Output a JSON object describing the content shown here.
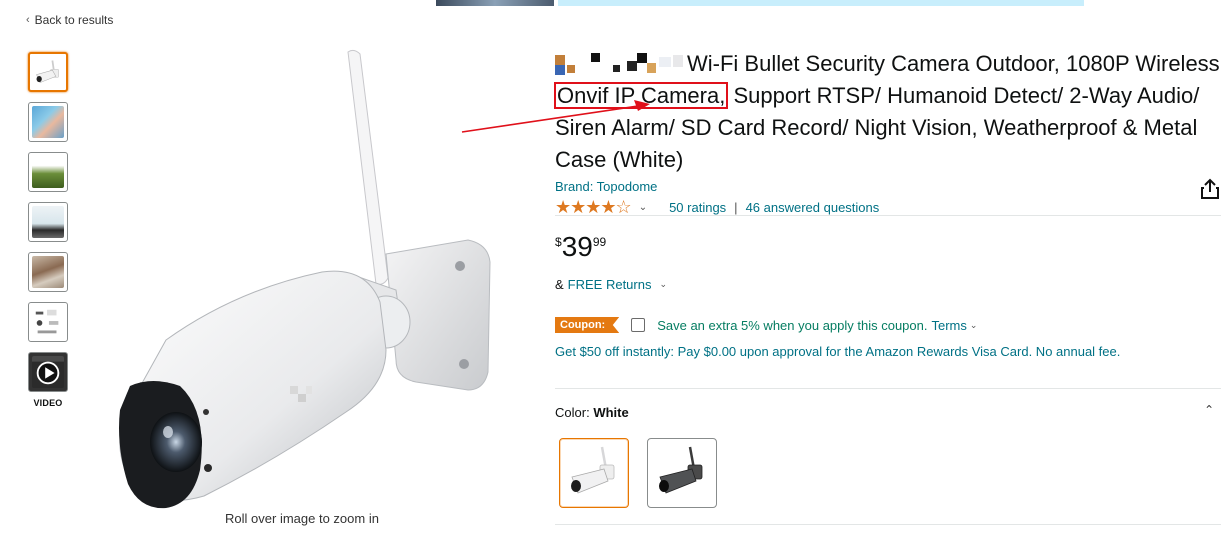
{
  "nav": {
    "back_label": "Back to results"
  },
  "gallery": {
    "video_label": "VIDEO",
    "zoom_hint": "Roll over image to zoom in"
  },
  "product": {
    "title_pre": "Wi-Fi Bullet Security Camera Outdoor, 1080P Wireless ",
    "title_highlight": "Onvif IP Camera,",
    "title_post": " Support RTSP/ Humanoid Detect/ 2-Way Audio/ Siren Alarm/ SD Card Record/ Night Vision, Weatherproof & Metal Case (White)",
    "brand": "Brand: Topodome",
    "rating_stars": "★★★★☆",
    "ratings_count": "50 ratings",
    "ratings_sep": "|",
    "answered_questions": "46 answered questions",
    "price_symbol": "$",
    "price_whole": "39",
    "price_fraction": "99",
    "returns_prefix": "&",
    "returns_link": "FREE Returns",
    "coupon_badge": "Coupon:",
    "coupon_text": "Save an extra 5% when you apply this coupon.",
    "coupon_terms": "Terms",
    "visa_offer": "Get $50 off instantly: Pay $0.00 upon approval for the Amazon Rewards Visa Card. No annual fee.",
    "color_label": "Color:",
    "color_value": "White"
  },
  "colors": {
    "accent_orange": "#e77600",
    "link_teal": "#007185",
    "coupon_green": "#067d62",
    "highlight_red": "#e0101a"
  }
}
